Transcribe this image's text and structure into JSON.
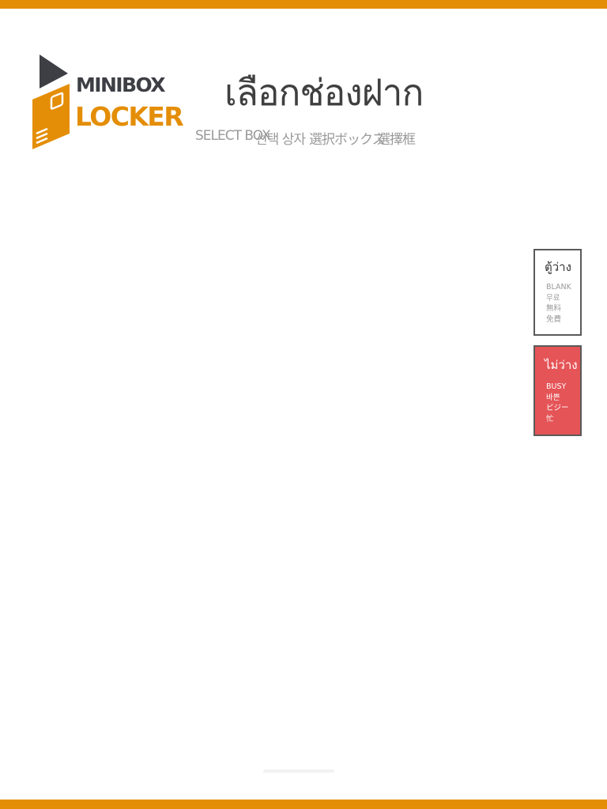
{
  "logo": {
    "line1": "MINIBOX",
    "line2": "LOCKER"
  },
  "header": {
    "title": "เลือกช่องฝาก",
    "subtitles": [
      "SELECT BOX",
      "선택 상자",
      "選択ボックス",
      "選擇框"
    ]
  },
  "legend": {
    "blank": {
      "title": "ตู้ว่าง",
      "labels": [
        "BLANK",
        "무료",
        "無料",
        "免費"
      ],
      "color": "#ffffff"
    },
    "busy": {
      "title": "ไม่ว่าง",
      "labels": [
        "BUSY",
        "바쁜",
        "ビジー",
        "忙"
      ],
      "color": "#e55457"
    }
  },
  "colors": {
    "accent": "#e48e07",
    "dark": "#3d3f45"
  }
}
